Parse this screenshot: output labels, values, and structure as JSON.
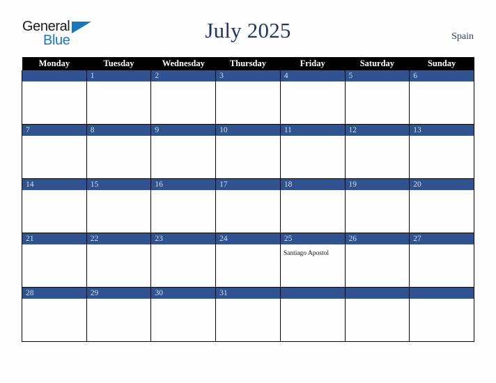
{
  "header": {
    "logo_primary": "General",
    "logo_secondary": "Blue",
    "title": "July 2025",
    "country": "Spain"
  },
  "calendar": {
    "weekday_headers": [
      "Monday",
      "Tuesday",
      "Wednesday",
      "Thursday",
      "Friday",
      "Saturday",
      "Sunday"
    ],
    "accent_color": "#2e5390",
    "header_color": "#000000",
    "title_color": "#21365f",
    "weeks": [
      [
        {
          "day": "",
          "event": ""
        },
        {
          "day": "1",
          "event": ""
        },
        {
          "day": "2",
          "event": ""
        },
        {
          "day": "3",
          "event": ""
        },
        {
          "day": "4",
          "event": ""
        },
        {
          "day": "5",
          "event": ""
        },
        {
          "day": "6",
          "event": ""
        }
      ],
      [
        {
          "day": "7",
          "event": ""
        },
        {
          "day": "8",
          "event": ""
        },
        {
          "day": "9",
          "event": ""
        },
        {
          "day": "10",
          "event": ""
        },
        {
          "day": "11",
          "event": ""
        },
        {
          "day": "12",
          "event": ""
        },
        {
          "day": "13",
          "event": ""
        }
      ],
      [
        {
          "day": "14",
          "event": ""
        },
        {
          "day": "15",
          "event": ""
        },
        {
          "day": "16",
          "event": ""
        },
        {
          "day": "17",
          "event": ""
        },
        {
          "day": "18",
          "event": ""
        },
        {
          "day": "19",
          "event": ""
        },
        {
          "day": "20",
          "event": ""
        }
      ],
      [
        {
          "day": "21",
          "event": ""
        },
        {
          "day": "22",
          "event": ""
        },
        {
          "day": "23",
          "event": ""
        },
        {
          "day": "24",
          "event": ""
        },
        {
          "day": "25",
          "event": "Santiago Apostol"
        },
        {
          "day": "26",
          "event": ""
        },
        {
          "day": "27",
          "event": ""
        }
      ],
      [
        {
          "day": "28",
          "event": ""
        },
        {
          "day": "29",
          "event": ""
        },
        {
          "day": "30",
          "event": ""
        },
        {
          "day": "31",
          "event": ""
        },
        {
          "day": "",
          "event": ""
        },
        {
          "day": "",
          "event": ""
        },
        {
          "day": "",
          "event": ""
        }
      ]
    ]
  }
}
